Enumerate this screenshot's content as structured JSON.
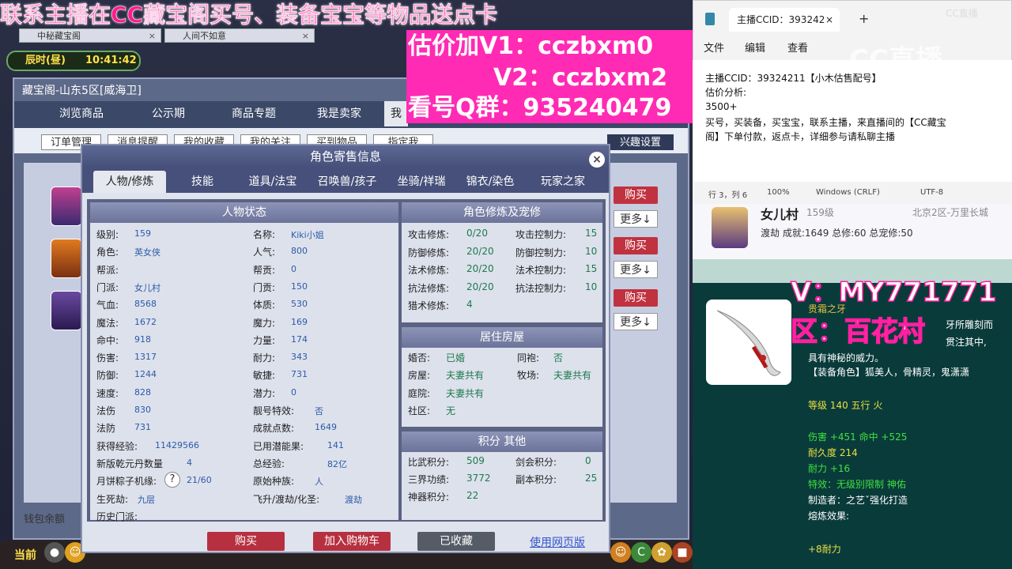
{
  "overlay": {
    "promo_line": "联系主播在CC藏宝阁买号、装备宝宝等物品送点卡",
    "v1": "估价加V1：cczbxm0",
    "v2": "V2：cczbxm2",
    "qq_group": "看号Q群：935240479"
  },
  "game": {
    "tabs": [
      "中秘藏宝阁",
      "人间不如意"
    ],
    "clock_period": "辰时(昼)",
    "clock_time": "10:41:42",
    "panel_title": "藏宝阁-山东5区[威海卫]",
    "nav_tabs": [
      "浏览商品",
      "公示期",
      "商品专题",
      "我是卖家",
      "我"
    ],
    "sub_buttons": [
      "订单管理",
      "消息提醒",
      "我的收藏",
      "我的关注",
      "买到物品",
      "指定我"
    ],
    "interest_settings": "兴趣设置",
    "buy_label": "购买",
    "more_label": "更多↓",
    "wallet": "钱包余额",
    "current_label": "当前"
  },
  "dialog": {
    "title": "角色寄售信息",
    "tabs": [
      "人物/修炼",
      "技能",
      "道具/法宝",
      "召唤兽/孩子",
      "坐骑/祥瑞",
      "锦衣/染色",
      "玩家之家"
    ],
    "status_title": "人物状态",
    "status_left": [
      {
        "label": "级别:",
        "value": "159"
      },
      {
        "label": "角色:",
        "value": "英女侠"
      },
      {
        "label": "帮派:",
        "value": ""
      },
      {
        "label": "门派:",
        "value": "女儿村"
      },
      {
        "label": "气血:",
        "value": "8568"
      },
      {
        "label": "魔法:",
        "value": "1672"
      },
      {
        "label": "命中:",
        "value": "918"
      },
      {
        "label": "伤害:",
        "value": "1317"
      },
      {
        "label": "防御:",
        "value": "1244"
      },
      {
        "label": "速度:",
        "value": "828"
      },
      {
        "label": "法伤",
        "value": "830"
      },
      {
        "label": "法防",
        "value": "731"
      },
      {
        "label": "获得经验:",
        "value": "11429566"
      },
      {
        "label": "新版乾元丹数量",
        "value": "4"
      },
      {
        "label": "月饼粽子机缘:",
        "value": "21/60"
      },
      {
        "label": "生死劫:",
        "value": "九层"
      },
      {
        "label": "历史门派:",
        "value": ""
      }
    ],
    "status_right": [
      {
        "label": "名称:",
        "value": "Kiki小姐"
      },
      {
        "label": "人气:",
        "value": "800"
      },
      {
        "label": "帮贡:",
        "value": "0"
      },
      {
        "label": "门贡:",
        "value": "150"
      },
      {
        "label": "体质:",
        "value": "530"
      },
      {
        "label": "魔力:",
        "value": "169"
      },
      {
        "label": "力量:",
        "value": "174"
      },
      {
        "label": "耐力:",
        "value": "343"
      },
      {
        "label": "敏捷:",
        "value": "731"
      },
      {
        "label": "潜力:",
        "value": "0"
      },
      {
        "label": "靓号特效:",
        "value": "否"
      },
      {
        "label": "成就点数:",
        "value": "1649"
      },
      {
        "label": "已用潜能果:",
        "value": "141"
      },
      {
        "label": "总经验:",
        "value": "82亿"
      },
      {
        "label": "原始种族:",
        "value": "人"
      },
      {
        "label": "飞升/渡劫/化圣:",
        "value": "渡劫"
      }
    ],
    "cultivation_title": "角色修炼及宠修",
    "cultivation": [
      {
        "label": "攻击修炼:",
        "value": "0/20",
        "label2": "攻击控制力:",
        "value2": "15"
      },
      {
        "label": "防御修炼:",
        "value": "20/20",
        "label2": "防御控制力:",
        "value2": "10"
      },
      {
        "label": "法术修炼:",
        "value": "20/20",
        "label2": "法术控制力:",
        "value2": "15"
      },
      {
        "label": "抗法修炼:",
        "value": "20/20",
        "label2": "抗法控制力:",
        "value2": "10"
      },
      {
        "label": "猎术修炼:",
        "value": "4",
        "label2": "",
        "value2": ""
      }
    ],
    "house_title": "居住房屋",
    "house": [
      {
        "label": "婚否:",
        "value": "已婚",
        "label2": "同袍:",
        "value2": "否"
      },
      {
        "label": "房屋:",
        "value": "夫妻共有",
        "label2": "牧场:",
        "value2": "夫妻共有"
      },
      {
        "label": "庭院:",
        "value": "夫妻共有",
        "label2": "",
        "value2": ""
      },
      {
        "label": "社区:",
        "value": "无",
        "label2": "",
        "value2": ""
      }
    ],
    "points_title": "积分 其他",
    "points": [
      {
        "label": "比武积分:",
        "value": "509",
        "label2": "剑会积分:",
        "value2": "0"
      },
      {
        "label": "三界功绩:",
        "value": "3772",
        "label2": "副本积分:",
        "value2": "25"
      },
      {
        "label": "神器积分:",
        "value": "22",
        "label2": "",
        "value2": ""
      }
    ],
    "buttons": {
      "buy": "购买",
      "add_cart": "加入购物车",
      "collected": "已收藏",
      "web": "使用网页版"
    }
  },
  "notepad": {
    "tab_title": "主播CCID：393242",
    "menu": [
      "文件",
      "编辑",
      "查看"
    ],
    "lines": [
      "主播CCID：39324211【小木估售配号】",
      "估价分析:",
      "3500+",
      "买号，买装备，买宝宝，联系主播，来直播间的【CC藏宝",
      "阁】下单付款，返点卡，详细参与请私聊主播"
    ],
    "status": [
      "行 3，列 6",
      "100%",
      "Windows (CRLF)",
      "UTF-8"
    ],
    "watermark": "CC直播"
  },
  "player": {
    "name": "女儿村",
    "level": "159级",
    "server": "北京2区-万里长城",
    "stats": "渡劫 成就:1649 总修:60 总宠修:50"
  },
  "item": {
    "v_label": "V：MY771771",
    "area_label": "区：百花村",
    "name": "贵霜之牙",
    "desc1": "牙所雕刻而",
    "desc2": "贯注其中,",
    "desc3": "具有神秘的威力。",
    "roles": "【装备角色】狐美人，骨精灵，鬼潇潇",
    "level_line": "等级 140 五行 火",
    "damage": "伤害 +451 命中 +525",
    "durability": "耐久度 214",
    "endurance": "耐力 +16",
    "effect": "特效：无级别限制 神佑",
    "maker": "制造者：之艺ˇ强化打造",
    "smelt": "熔炼效果:",
    "smelt_val": "+8耐力"
  }
}
